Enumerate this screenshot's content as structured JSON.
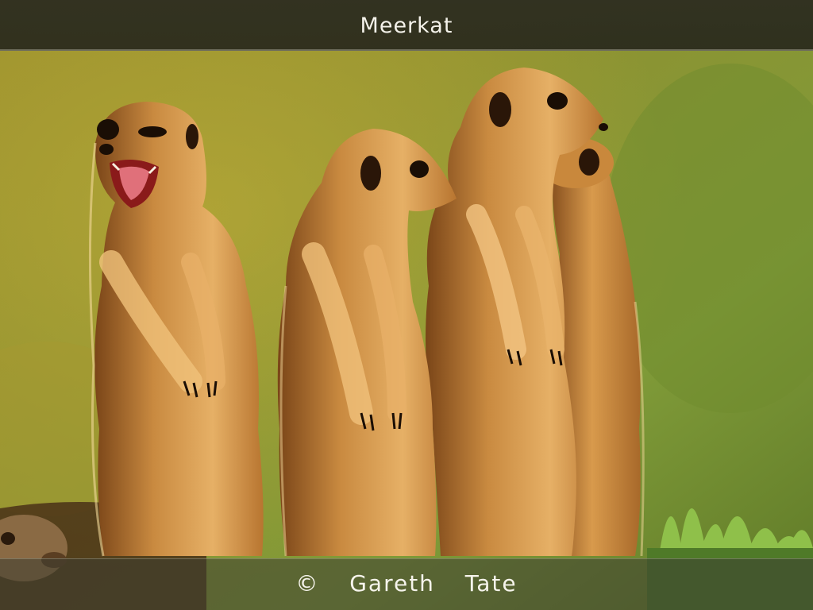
{
  "header": {
    "title": "Meerkat"
  },
  "photo": {
    "subject": "meerkat-group-photo",
    "colors": {
      "background": "#8a8f2a",
      "fur": "#c8843a",
      "fur_light": "#e8b064",
      "fur_dark": "#6b3c16",
      "leaves": "#8fc04a"
    }
  },
  "caption": {
    "credit": "©  Gareth  Tate"
  }
}
